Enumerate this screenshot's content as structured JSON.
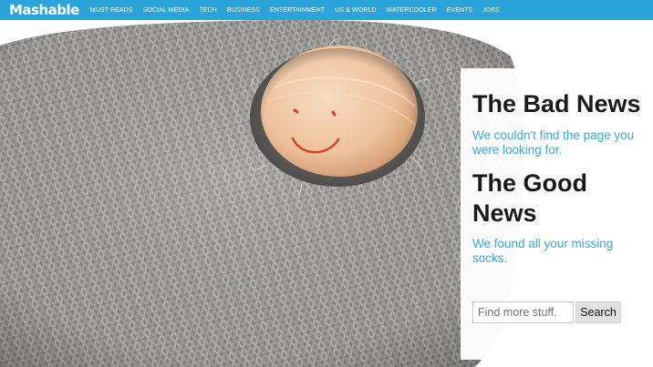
{
  "header": {
    "logo_text": "Mashable",
    "nav_items": [
      "MUST READS",
      "SOCIAL MEDIA",
      "TECH",
      "BUSINESS",
      "ENTERTAINMENT",
      "US & WORLD",
      "WATERCOOLER",
      "EVENTS",
      "JOBS"
    ],
    "brand_color": "#2aa4d9"
  },
  "hero": {
    "image": "gray-knit-sock-with-toe-hole-smiley-face"
  },
  "message": {
    "bad_title": "The Bad News",
    "bad_text": "We couldn't find the page you were looking for.",
    "good_title": "The Good News",
    "good_text": "We found all your missing socks.",
    "accent_color": "#3aa8dc"
  },
  "search": {
    "placeholder": "Find more stuff.",
    "button_label": "Search"
  }
}
